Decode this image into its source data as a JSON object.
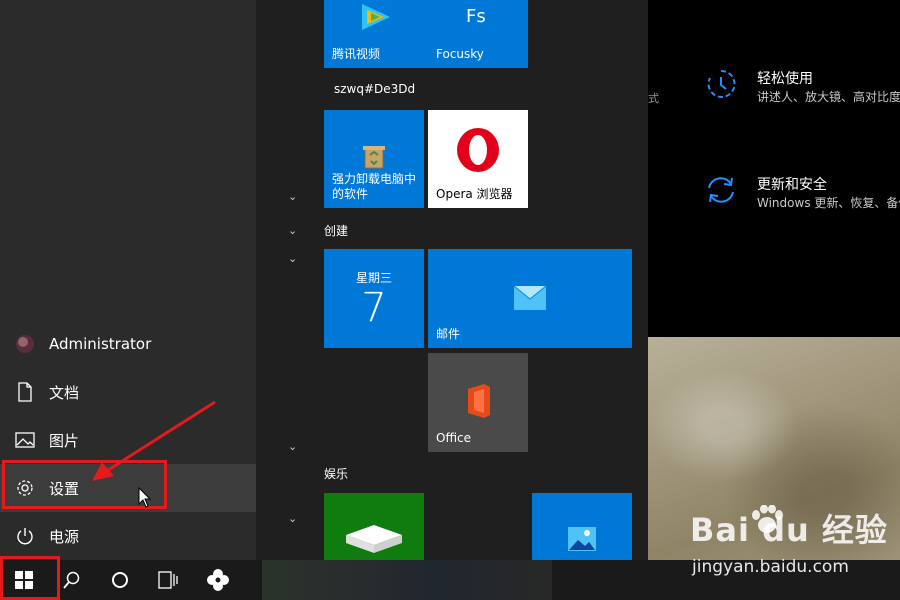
{
  "settings_panel": {
    "stray_text": "式",
    "items": [
      {
        "title": "轻松使用",
        "desc": "讲述人、放大镜、高对比度",
        "icon": "ease-of-access-icon"
      },
      {
        "title": "更新和安全",
        "desc": "Windows 更新、恢复、备份",
        "icon": "update-sync-icon"
      }
    ]
  },
  "start_menu": {
    "rail": {
      "user": "Administrator",
      "documents": "文档",
      "pictures": "图片",
      "settings": "设置",
      "power": "电源"
    },
    "tiles": {
      "tencent_video": "腾讯视频",
      "focusky": "Focusky",
      "focusky_glyph": "Fs",
      "group_szwq": "szwq#De3Dd",
      "uninstaller": "强力卸载电脑中的软件",
      "opera": "Opera 浏览器",
      "group_create": "创建",
      "calendar_weekday": "星期三",
      "calendar_day": "7",
      "mail": "邮件",
      "office": "Office",
      "group_entertainment": "娱乐"
    }
  },
  "watermark": {
    "brand": "Bai du 经验",
    "url": "jingyan.baidu.com"
  },
  "colors": {
    "tile_blue": "#0078d7",
    "annotation_red": "#e41a1c",
    "xbox_green": "#107c10"
  }
}
